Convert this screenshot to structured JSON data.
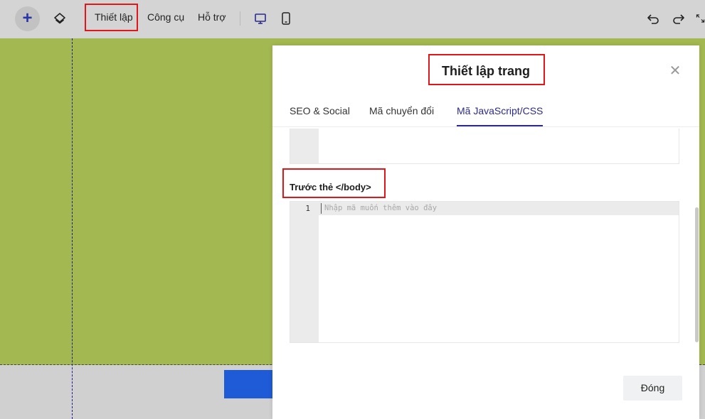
{
  "toolbar": {
    "add_label": "+",
    "menu": [
      "Thiết lập",
      "Công cụ",
      "Hỗ trợ"
    ]
  },
  "modal": {
    "title": "Thiết lập trang",
    "tabs": [
      "SEO & Social",
      "Mã chuyển đổi",
      "Mã JavaScript/CSS"
    ],
    "active_tab": "Mã JavaScript/CSS",
    "section_label": "Trước thẻ </body>",
    "editor": {
      "line_number": "1",
      "placeholder": "Nhập mã muốn thêm vào đây"
    },
    "close_button": "Đóng"
  },
  "colors": {
    "accent": "#2c2a8c",
    "highlight": "#e0161b",
    "canvas_green": "#a3b850",
    "blue_block": "#1f5bd6"
  }
}
